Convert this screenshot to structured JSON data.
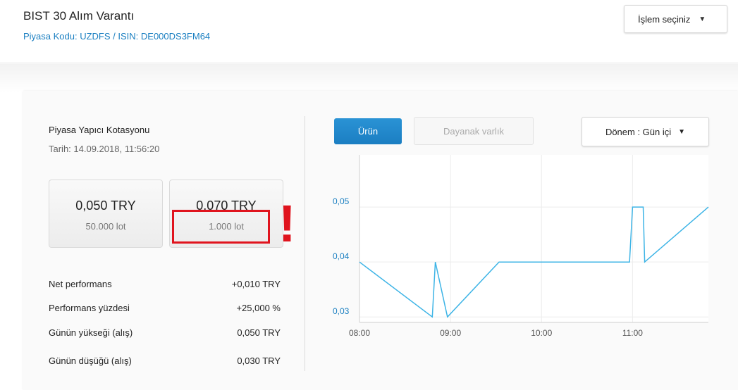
{
  "header": {
    "title": "BIST 30 Alım Varantı",
    "subtitle": "Piyasa Kodu: UZDFS / ISIN: DE000DS3FM64",
    "action_label": "İşlem seçiniz"
  },
  "quote": {
    "title": "Piyasa Yapıcı Kotasyonu",
    "date": "Tarih: 14.09.2018, 11:56:20",
    "bid": {
      "price": "0,050 TRY",
      "lot": "50.000 lot"
    },
    "ask": {
      "price": "0,070 TRY",
      "lot": "1.000 lot"
    },
    "alert_mark": "!"
  },
  "stats": [
    {
      "label": "Net performans",
      "value": "+0,010 TRY"
    },
    {
      "label": "Performans yüzdesi",
      "value": "+25,000 %"
    },
    {
      "label": "Günün yükseği (alış)",
      "value": "0,050 TRY"
    },
    {
      "label": "Günün düşüğü (alış)",
      "value": "0,030 TRY"
    }
  ],
  "chart_tabs": {
    "active": "Ürün",
    "inactive": "Dayanak varlık"
  },
  "period": {
    "label": "Dönem : Gün içi"
  },
  "colors": {
    "accent": "#1b7ec2",
    "line": "#3db4e6",
    "alert": "#e0141e"
  },
  "chart_data": {
    "type": "line",
    "x_ticks": [
      "08:00",
      "09:00",
      "10:00",
      "11:00"
    ],
    "y_ticks": [
      "0,03",
      "0,04",
      "0,05"
    ],
    "ylim": [
      0.029,
      0.0595
    ],
    "xlim": [
      "08:00",
      "11:50"
    ],
    "grid": true,
    "series": [
      {
        "x": [
          "08:00",
          "08:48",
          "08:50",
          "08:58",
          "09:32",
          "10:58",
          "11:00",
          "11:07",
          "11:08",
          "11:50"
        ],
        "y": [
          0.04,
          0.03,
          0.04,
          0.03,
          0.04,
          0.04,
          0.05,
          0.05,
          0.04,
          0.05
        ]
      }
    ]
  }
}
